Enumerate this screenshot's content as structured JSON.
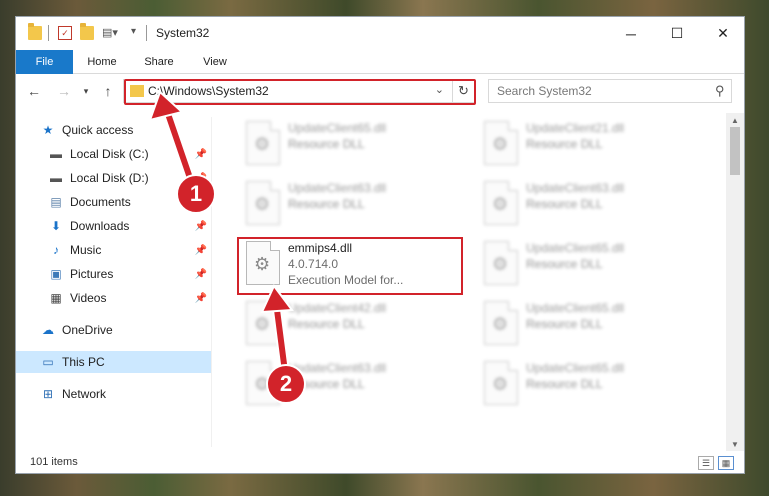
{
  "window": {
    "title": "System32",
    "quick_access_toolbar": [
      "folder-icon",
      "properties-icon",
      "new-folder-icon",
      "customize-icon"
    ],
    "controls": {
      "minimize": "─",
      "maximize": "☐",
      "close": "✕"
    }
  },
  "ribbon": {
    "tabs": [
      {
        "label": "File",
        "active": true
      },
      {
        "label": "Home"
      },
      {
        "label": "Share"
      },
      {
        "label": "View"
      }
    ]
  },
  "address_bar": {
    "path": "C:\\Windows\\System32",
    "search_placeholder": "Search System32"
  },
  "sidebar": {
    "items": [
      {
        "label": "Quick access",
        "icon": "star-icon",
        "pinned": false,
        "selected": false
      },
      {
        "label": "Local Disk (C:)",
        "icon": "drive-icon",
        "pinned": true,
        "selected": false
      },
      {
        "label": "Local Disk (D:)",
        "icon": "drive-icon",
        "pinned": true,
        "selected": false
      },
      {
        "label": "Documents",
        "icon": "documents-icon",
        "pinned": true,
        "selected": false
      },
      {
        "label": "Downloads",
        "icon": "download-icon",
        "pinned": true,
        "selected": false
      },
      {
        "label": "Music",
        "icon": "music-icon",
        "pinned": true,
        "selected": false
      },
      {
        "label": "Pictures",
        "icon": "pictures-icon",
        "pinned": true,
        "selected": false
      },
      {
        "label": "Videos",
        "icon": "videos-icon",
        "pinned": true,
        "selected": false
      },
      {
        "label": "OneDrive",
        "icon": "cloud-icon",
        "pinned": false,
        "selected": false
      },
      {
        "label": "This PC",
        "icon": "computer-icon",
        "pinned": false,
        "selected": true
      },
      {
        "label": "Network",
        "icon": "network-icon",
        "pinned": false,
        "selected": false
      }
    ]
  },
  "files": [
    {
      "name": "UpdateClient65.dll",
      "line1": "Resource DLL",
      "line2": "",
      "blurred": true
    },
    {
      "name": "UpdateClient21.dll",
      "line1": "Resource DLL",
      "line2": "",
      "blurred": true
    },
    {
      "name": "UpdateClient63.dll",
      "line1": "Resource DLL",
      "line2": "",
      "blurred": true
    },
    {
      "name": "UpdateClient63.dll",
      "line1": "Resource DLL",
      "line2": "",
      "blurred": true
    },
    {
      "name": "emmips4.dll",
      "line1": "4.0.714.0",
      "line2": "Execution Model for...",
      "blurred": false
    },
    {
      "name": "UpdateClient65.dll",
      "line1": "Resource DLL",
      "line2": "",
      "blurred": true
    },
    {
      "name": "UpdateClient42.dll",
      "line1": "Resource DLL",
      "line2": "",
      "blurred": true
    },
    {
      "name": "UpdateClient65.dll",
      "line1": "Resource DLL",
      "line2": "",
      "blurred": true
    },
    {
      "name": "UpdateClient63.dll",
      "line1": "Resource DLL",
      "line2": "",
      "blurred": true
    },
    {
      "name": "UpdateClient65.dll",
      "line1": "Resource DLL",
      "line2": "",
      "blurred": true
    }
  ],
  "status_bar": {
    "item_count": "101 items"
  },
  "annotations": {
    "step1": "1",
    "step2": "2",
    "highlight_color": "#d2232a"
  }
}
